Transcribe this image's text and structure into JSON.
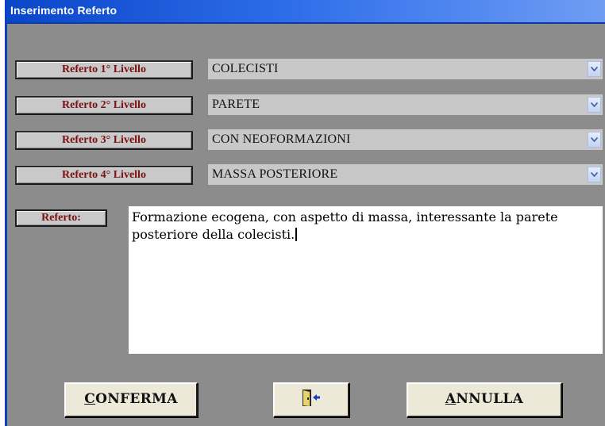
{
  "window": {
    "title": "Inserimento Referto"
  },
  "levels": [
    {
      "label": "Referto 1° Livello",
      "value": "COLECISTI"
    },
    {
      "label": "Referto 2° Livello",
      "value": "PARETE"
    },
    {
      "label": "Referto 3° Livello",
      "value": "CON NEOFORMAZIONI"
    },
    {
      "label": "Referto 4° Livello",
      "value": "MASSA POSTERIORE"
    }
  ],
  "referto": {
    "label": "Referto:",
    "text": "Formazione ecogena, con aspetto di massa, interessante la parete posteriore della colecisti."
  },
  "buttons": {
    "confirm": {
      "first": "C",
      "rest": "ONFERMA"
    },
    "exit_icon": "exit-door-icon",
    "cancel": {
      "first": "A",
      "rest": "NNULLA"
    }
  },
  "colors": {
    "title_bar": "#0a46c8",
    "background": "#8c8c8c",
    "label_text": "#7a1010",
    "button_face": "#ece9d8"
  }
}
